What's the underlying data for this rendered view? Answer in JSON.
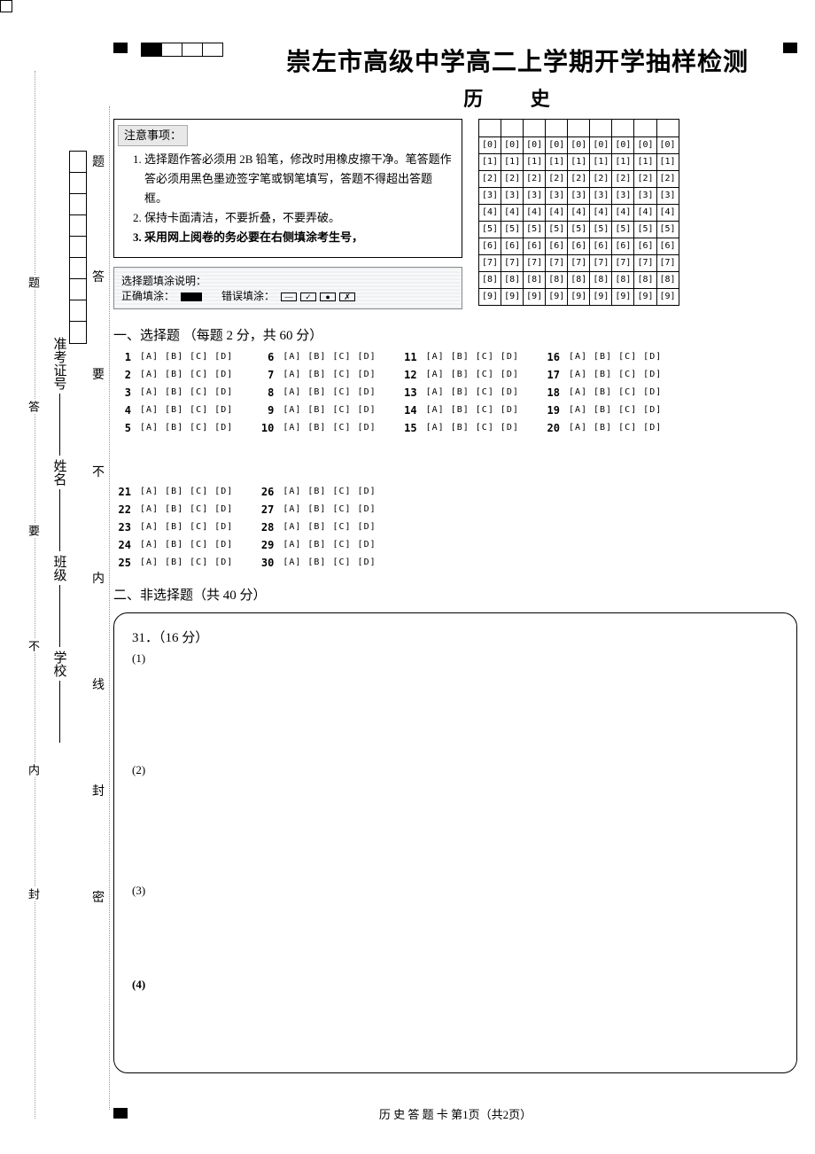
{
  "header": {
    "title": "崇左市高级中学高二上学期开学抽样检测",
    "subject": "历 史"
  },
  "notes": {
    "heading": "注意事项：",
    "items": [
      "选择题作答必须用 2B 铅笔，修改时用橡皮擦干净。笔答题作答必须用黑色墨迹签字笔或钢笔填写，答题不得超出答题框。",
      "保持卡面清洁，不要折叠，不要弄破。",
      "采用网上阅卷的务必要在右侧填涂考生号，"
    ],
    "fill_label": "选择题填涂说明：",
    "correct_label": "正确填涂：",
    "wrong_label": "错误填涂："
  },
  "id_grid": {
    "digits": [
      "0",
      "1",
      "2",
      "3",
      "4",
      "5",
      "6",
      "7",
      "8",
      "9"
    ],
    "cols": 9
  },
  "sections": {
    "mcq_heading": "一、选择题 （每题 2 分，共 60 分）",
    "frq_heading": "二、非选择题（共 40 分）",
    "frq_q": "31．（16 分）",
    "sub1": "(1)",
    "sub2": "(2)",
    "sub3": "(3)",
    "sub4": "(4)"
  },
  "bubble_text": "[A] [B] [C] [D]",
  "mcq_numbers": {
    "col1": [
      "1",
      "2",
      "3",
      "4",
      "5"
    ],
    "col2": [
      "6",
      "7",
      "8",
      "9",
      "10"
    ],
    "col3": [
      "11",
      "12",
      "13",
      "14",
      "15"
    ],
    "col4": [
      "16",
      "17",
      "18",
      "19",
      "20"
    ],
    "col5": [
      "21",
      "22",
      "23",
      "24",
      "25"
    ],
    "col6": [
      "26",
      "27",
      "28",
      "29",
      "30"
    ]
  },
  "gutter": {
    "g1": "题",
    "g2": "答",
    "g3": "要",
    "g4": "不",
    "g5": "内",
    "g6": "线",
    "g7": "封",
    "g8": "密"
  },
  "cut": {
    "c1": "题",
    "c2": "答",
    "c3": "要",
    "c4": "不",
    "c5": "内",
    "c6": "线",
    "vt": "封",
    "vt2": "密"
  },
  "binding": {
    "school": "学校",
    "class": "班级",
    "name": "姓名",
    "ticket": "准考证号"
  },
  "footer": "历 史 答 题 卡  第1页（共2页）"
}
